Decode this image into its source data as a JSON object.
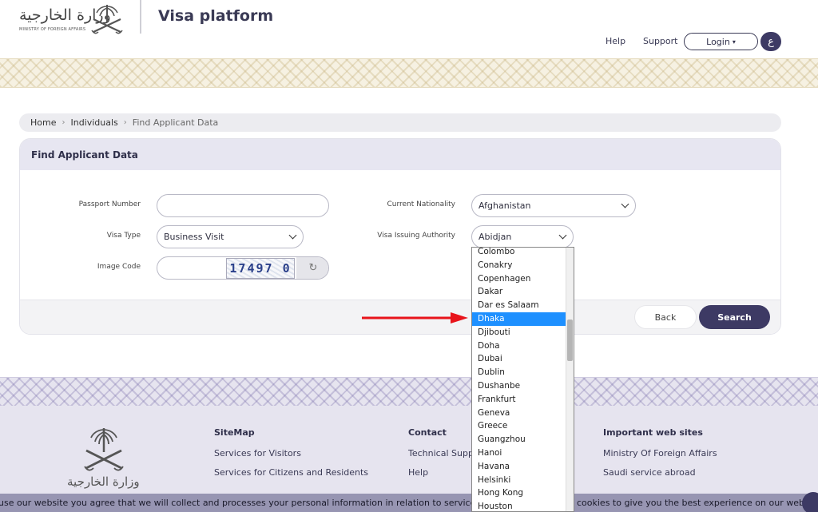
{
  "header": {
    "logo_ar": "وزارة الخارجية",
    "logo_en": "MINISTRY OF FOREIGN AFFAIRS",
    "brand": "Visa platform",
    "help": "Help",
    "support": "Support",
    "login": "Login",
    "login_caret": "▾",
    "lang": "ع"
  },
  "breadcrumb": {
    "home": "Home",
    "individuals": "Individuals",
    "current": "Find Applicant Data",
    "sep": "›"
  },
  "form": {
    "title": "Find Applicant Data",
    "passport_label": "Passport Number",
    "passport_value": "",
    "nationality_label": "Current Nationality",
    "nationality_value": "Afghanistan",
    "visa_type_label": "Visa Type",
    "visa_type_value": "Business Visit",
    "authority_label": "Visa Issuing Authority",
    "authority_value": "Abidjan",
    "image_code_label": "Image Code",
    "image_code_value": "",
    "captcha_text": "17497 0",
    "refresh_glyph": "↻",
    "back": "Back",
    "search": "Search"
  },
  "dropdown": {
    "items": [
      "Colombo",
      "Conakry",
      "Copenhagen",
      "Dakar",
      "Dar es Salaam",
      "Dhaka",
      "Djibouti",
      "Doha",
      "Dubai",
      "Dublin",
      "Dushanbe",
      "Frankfurt",
      "Geneva",
      "Greece",
      "Guangzhou",
      "Hanoi",
      "Havana",
      "Helsinki",
      "Hong Kong",
      "Houston"
    ],
    "selected": "Dhaka"
  },
  "footer": {
    "logo_ar": "وزارة الخارجية",
    "sitemap_head": "SiteMap",
    "sitemap_1": "Services for Visitors",
    "sitemap_2": "Services for Citizens and Residents",
    "contact_head": "Contact",
    "contact_1": "Technical Suppo",
    "contact_2": "Help",
    "sites_head": "Important web sites",
    "sites_1": "Ministry Of Foreign Affairs",
    "sites_2": "Saudi service abroad"
  },
  "cookie": {
    "left": "use our website you agree that we will collect and processes your personal information in relation to services provide",
    "right": "cookies to give you the best experience on our website."
  },
  "colors": {
    "primary": "#3d3a64",
    "selected_item": "#1e90ff",
    "arrow": "#e8141b"
  }
}
